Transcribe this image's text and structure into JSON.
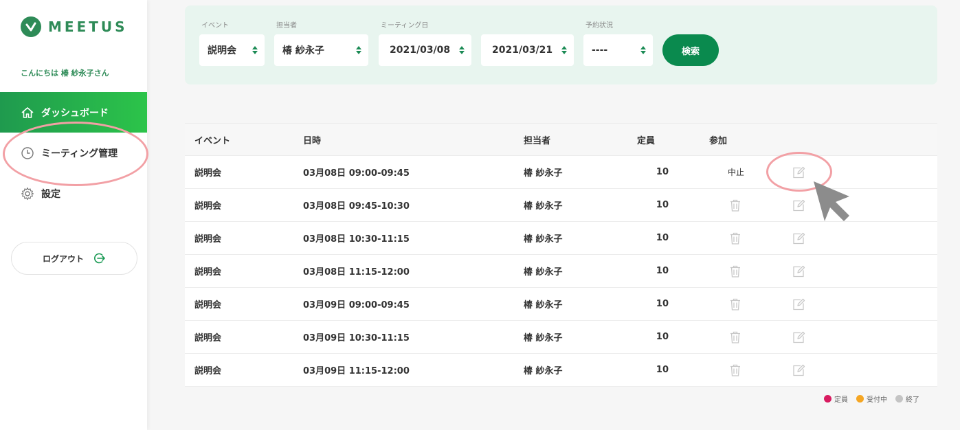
{
  "brand": {
    "name": "MEETUS",
    "color": "#2e8b57"
  },
  "greeting": "こんにちは 椿 紗永子さん",
  "nav": [
    {
      "label": "ダッシュボード",
      "icon": "home-icon",
      "active": true
    },
    {
      "label": "ミーティング管理",
      "icon": "clock-icon",
      "active": false
    },
    {
      "label": "設定",
      "icon": "gear-icon",
      "active": false
    }
  ],
  "logout": {
    "label": "ログアウト",
    "icon": "logout-icon"
  },
  "search": {
    "event": {
      "label": "イベント",
      "value": "説明会"
    },
    "staff": {
      "label": "担当者",
      "value": "椿 紗永子"
    },
    "meeting_date": {
      "label": "ミーティング日",
      "from": "2021/03/08",
      "to": "2021/03/21"
    },
    "status": {
      "label": "予約状況",
      "value": "----"
    },
    "button": "検索"
  },
  "table": {
    "headers": {
      "event": "イベント",
      "date": "日時",
      "staff": "担当者",
      "capacity": "定員",
      "join": "参加"
    },
    "rows": [
      {
        "event": "説明会",
        "date": "03月08日 09:00-09:45",
        "staff": "椿 紗永子",
        "capacity": "10",
        "join": "中止"
      },
      {
        "event": "説明会",
        "date": "03月08日 09:45-10:30",
        "staff": "椿 紗永子",
        "capacity": "10",
        "join": ""
      },
      {
        "event": "説明会",
        "date": "03月08日 10:30-11:15",
        "staff": "椿 紗永子",
        "capacity": "10",
        "join": ""
      },
      {
        "event": "説明会",
        "date": "03月08日 11:15-12:00",
        "staff": "椿 紗永子",
        "capacity": "10",
        "join": ""
      },
      {
        "event": "説明会",
        "date": "03月09日 09:00-09:45",
        "staff": "椿 紗永子",
        "capacity": "10",
        "join": ""
      },
      {
        "event": "説明会",
        "date": "03月09日 10:30-11:15",
        "staff": "椿 紗永子",
        "capacity": "10",
        "join": ""
      },
      {
        "event": "説明会",
        "date": "03月09日 11:15-12:00",
        "staff": "椿 紗永子",
        "capacity": "10",
        "join": ""
      }
    ]
  },
  "legend": [
    {
      "label": "定員",
      "color": "#d81b60"
    },
    {
      "label": "受付中",
      "color": "#f5a623"
    },
    {
      "label": "終了",
      "color": "#c4c4c4"
    }
  ]
}
